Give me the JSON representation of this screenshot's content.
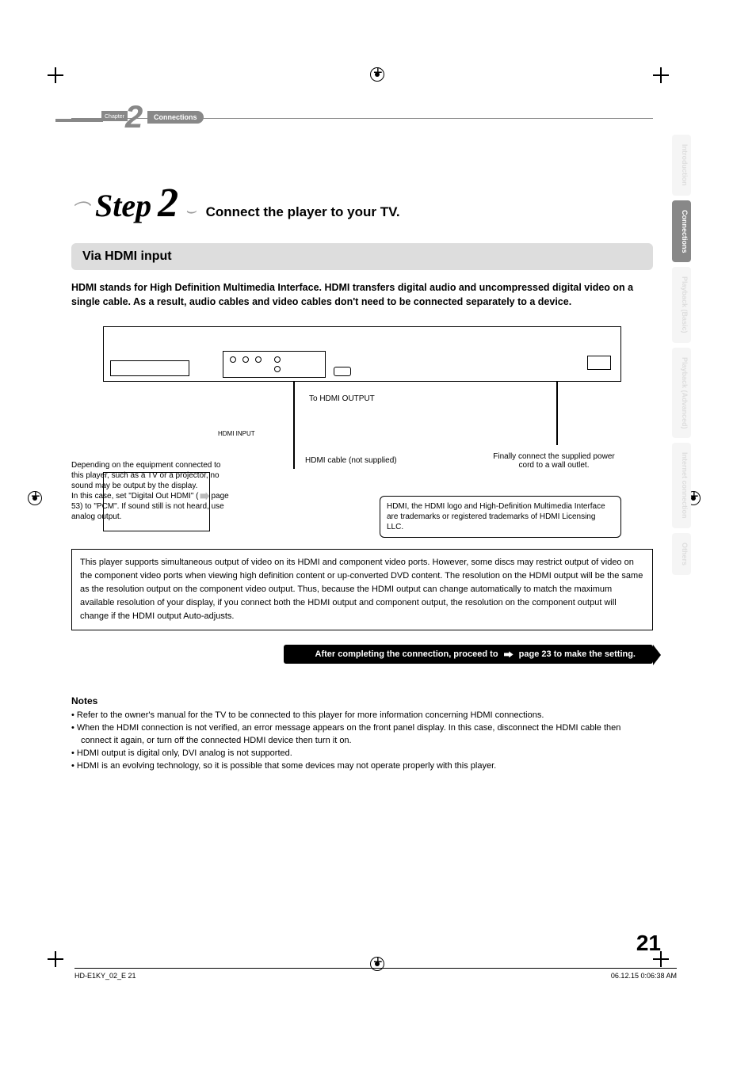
{
  "chapter": {
    "word": "Chapter",
    "number": "2",
    "label": "Connections"
  },
  "side_tabs": [
    "Introduction",
    "Connections",
    "Playback (Basic)",
    "Playback (Advanced)",
    "Internet connection",
    "Others"
  ],
  "step": {
    "curve": "⌒",
    "word": "Step",
    "num": "2",
    "title": "Connect the player to your TV."
  },
  "section_bar": "Via HDMI input",
  "intro": "HDMI stands for High Definition Multimedia Interface. HDMI transfers digital audio and uncompressed digital video on a single cable. As a result, audio cables and video cables don't need to be connected separately to a device.",
  "diagram": {
    "hdmi_out": "To HDMI OUTPUT",
    "hdmi_cable": "HDMI cable (not supplied)",
    "power": "Finally connect the supplied power cord to a wall outlet.",
    "hdmi_input": "HDMI INPUT",
    "left_note_1": "Depending on the equipment connected to this player, such as a TV or a projector, no sound may be output by the display.",
    "left_note_2": "In this case, set \"Digital Out HDMI\" (",
    "left_note_3": "page 53) to \"PCM\". If sound still is not heard, use analog output.",
    "trademark": "HDMI, the HDMI logo and High-Definition Multimedia Interface are trademarks or registered trademarks of HDMI Licensing LLC."
  },
  "support_box": "This player supports simultaneous output of video on its HDMI and component video ports. However, some discs may restrict output of video on the component video ports when viewing high definition content or up-converted DVD content. The resolution on the HDMI output will be the same as the resolution output on the component video output. Thus, because the HDMI output can change automatically to match the maximum available resolution of your display, if you connect both the HDMI output and component output, the resolution on the component output will change if the HDMI output Auto-adjusts.",
  "proceed": {
    "before": "After completing the connection, proceed to",
    "after": "page 23 to make the setting."
  },
  "notes_heading": "Notes",
  "notes": [
    "Refer to the owner's manual for the TV to be connected to this player for more information concerning HDMI connections.",
    "When the HDMI connection is not verified, an error message appears on the front panel display. In this case, disconnect the HDMI cable then connect it again, or turn off the connected HDMI device then turn it on.",
    "HDMI output is digital only, DVI analog is not supported.",
    "HDMI is an evolving technology, so it is possible that some devices may not operate properly with this player."
  ],
  "page_number": "21",
  "footer": {
    "left": "HD-E1KY_02_E   21",
    "right": "06.12.15   0:06:38 AM"
  }
}
